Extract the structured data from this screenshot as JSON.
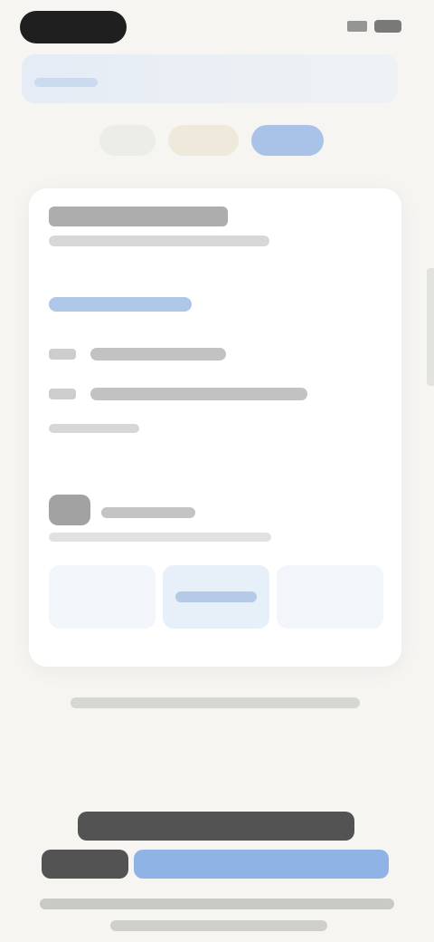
{
  "status_bar": {
    "time": "",
    "icons": [
      "signal-icon",
      "battery-icon"
    ]
  },
  "tabs": [
    {
      "label": ""
    },
    {
      "label": ""
    },
    {
      "label": "",
      "selected": true
    }
  ],
  "card": {
    "title": "",
    "subtitle": "",
    "link": "",
    "rows": [
      {
        "icon": "row-icon",
        "label": ""
      },
      {
        "icon": "row-icon",
        "label": ""
      }
    ],
    "note": "",
    "profile": {
      "name": "",
      "meta": ""
    },
    "buttons": [
      {
        "label": ""
      },
      {
        "label": ""
      },
      {
        "label": ""
      }
    ]
  },
  "caption": "",
  "hero": {
    "line1": "",
    "line2_plain": "",
    "line2_highlight": "",
    "sub": ""
  },
  "colors": {
    "background": "#f6f5f2",
    "accent": "#7ea7e3",
    "card": "#ffffff"
  }
}
